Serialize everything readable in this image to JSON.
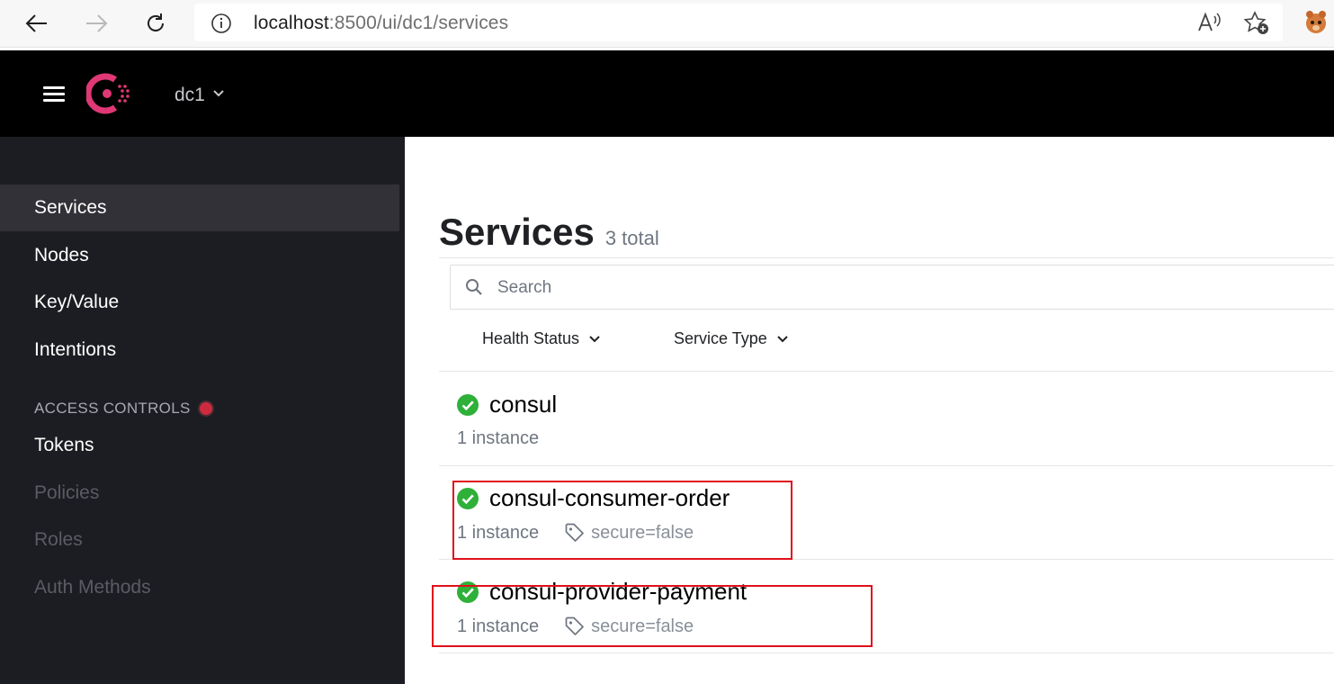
{
  "browser": {
    "url_host": "localhost",
    "url_rest": ":8500/ui/dc1/services"
  },
  "header": {
    "datacenter": "dc1"
  },
  "sidebar": {
    "items": [
      {
        "label": "Services"
      },
      {
        "label": "Nodes"
      },
      {
        "label": "Key/Value"
      },
      {
        "label": "Intentions"
      }
    ],
    "access_controls_heading": "ACCESS CONTROLS",
    "access_items": [
      {
        "label": "Tokens"
      },
      {
        "label": "Policies"
      },
      {
        "label": "Roles"
      },
      {
        "label": "Auth Methods"
      }
    ]
  },
  "main": {
    "title": "Services",
    "total": "3 total",
    "search_placeholder": "Search",
    "filters": [
      {
        "label": "Health Status"
      },
      {
        "label": "Service Type"
      }
    ],
    "services": [
      {
        "name": "consul",
        "instances": "1 instance",
        "tag": ""
      },
      {
        "name": "consul-consumer-order",
        "instances": "1 instance",
        "tag": "secure=false"
      },
      {
        "name": "consul-provider-payment",
        "instances": "1 instance",
        "tag": "secure=false"
      }
    ]
  },
  "colors": {
    "brand": "#e03875",
    "passing": "#2eb039",
    "annotation": "#e0101a"
  }
}
